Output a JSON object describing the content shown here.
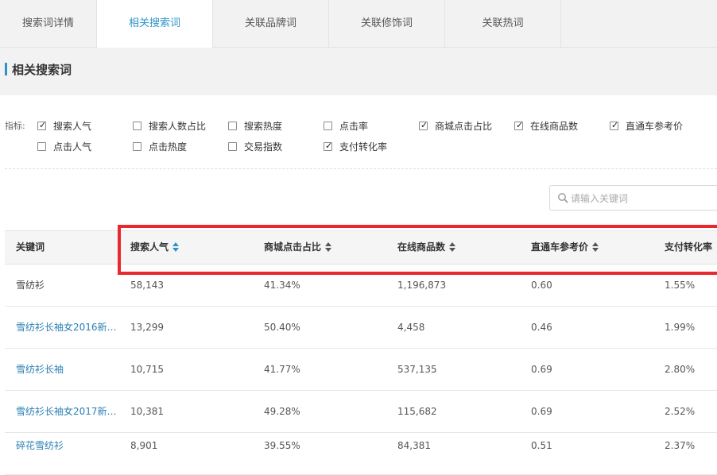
{
  "tabs": [
    {
      "label": "搜索词详情",
      "active": false
    },
    {
      "label": "相关搜索词",
      "active": true
    },
    {
      "label": "关联品牌词",
      "active": false
    },
    {
      "label": "关联修饰词",
      "active": false
    },
    {
      "label": "关联热词",
      "active": false
    }
  ],
  "section": {
    "title": "相关搜索词"
  },
  "indicators": {
    "label": "指标:",
    "items": [
      {
        "label": "搜索人气",
        "checked": true
      },
      {
        "label": "搜索人数占比",
        "checked": false
      },
      {
        "label": "搜索热度",
        "checked": false
      },
      {
        "label": "点击率",
        "checked": false
      },
      {
        "label": "商城点击占比",
        "checked": true
      },
      {
        "label": "在线商品数",
        "checked": true
      },
      {
        "label": "直通车参考价",
        "checked": true
      },
      {
        "label": "点击人气",
        "checked": false
      },
      {
        "label": "点击热度",
        "checked": false
      },
      {
        "label": "交易指数",
        "checked": false
      },
      {
        "label": "支付转化率",
        "checked": true
      }
    ]
  },
  "search": {
    "placeholder": "请输入关键词",
    "value": ""
  },
  "table": {
    "columns": [
      "关键词",
      "搜索人气",
      "商城点击占比",
      "在线商品数",
      "直通车参考价",
      "支付转化率"
    ],
    "rows": [
      [
        "雪纺衫",
        "58,143",
        "41.34%",
        "1,196,873",
        "0.60",
        "1.55%"
      ],
      [
        "雪纺衫长袖女2016新款…",
        "13,299",
        "50.40%",
        "4,458",
        "0.46",
        "1.99%"
      ],
      [
        "雪纺衫长袖",
        "10,715",
        "41.77%",
        "537,135",
        "0.69",
        "2.80%"
      ],
      [
        "雪纺衫长袖女2017新款…",
        "10,381",
        "49.28%",
        "115,682",
        "0.69",
        "2.52%"
      ],
      [
        "碎花雪纺衫",
        "8,901",
        "39.55%",
        "84,381",
        "0.51",
        "2.37%"
      ]
    ]
  },
  "colors": {
    "accent": "#2b95c9",
    "link": "#2b7fb3",
    "highlight": "#e8272e"
  }
}
